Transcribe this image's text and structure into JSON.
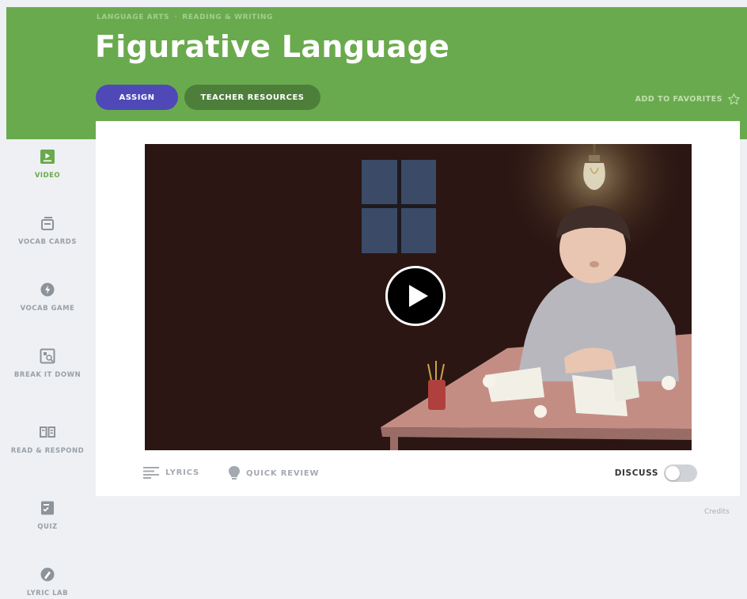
{
  "breadcrumb": [
    "LANGUAGE ARTS",
    "READING & WRITING"
  ],
  "title": "Figurative Language",
  "buttons": {
    "assign": "ASSIGN",
    "teacher_resources": "TEACHER RESOURCES"
  },
  "favorites_label": "ADD TO FAVORITES",
  "sidebar": {
    "items": [
      {
        "label": "VIDEO",
        "icon": "video-icon",
        "active": true
      },
      {
        "label": "VOCAB CARDS",
        "icon": "vocab-cards-icon"
      },
      {
        "label": "VOCAB GAME",
        "icon": "vocab-game-icon"
      },
      {
        "label": "BREAK IT DOWN",
        "icon": "break-it-down-icon"
      },
      {
        "label": "READ & RESPOND",
        "icon": "read-respond-icon"
      },
      {
        "label": "QUIZ",
        "icon": "quiz-icon"
      },
      {
        "label": "LYRIC LAB",
        "icon": "lyric-lab-icon"
      }
    ]
  },
  "video_controls": {
    "lyrics": "LYRICS",
    "quick_review": "QUICK REVIEW",
    "discuss": "DISCUSS",
    "discuss_enabled": false
  },
  "credits": "Credits",
  "colors": {
    "header_green": "#6aaa4e",
    "assign_purple": "#4f49b8",
    "teacher_green": "#4d7f3a",
    "active_green": "#6aaa4e"
  }
}
